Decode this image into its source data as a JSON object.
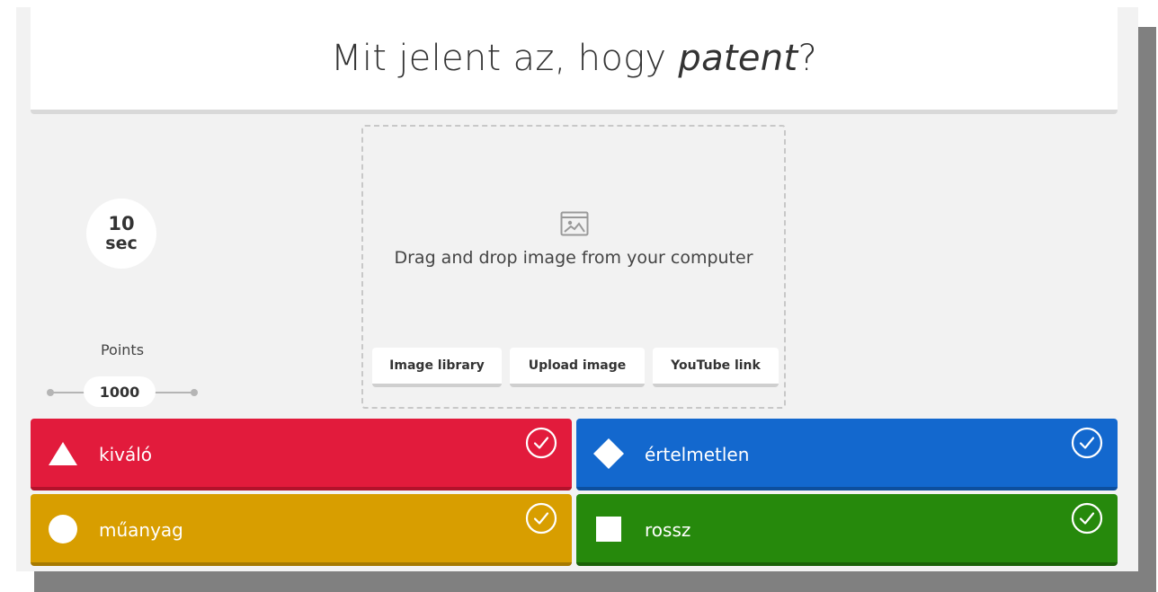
{
  "question": {
    "prefix": "Mit jelent az, hogy ",
    "emphasis": "patent",
    "suffix": "?"
  },
  "timer": {
    "value": "10",
    "unit": "sec"
  },
  "points": {
    "label": "Points",
    "value": "1000"
  },
  "media": {
    "drop_text": "Drag and drop image from your computer",
    "buttons": [
      "Image library",
      "Upload image",
      "YouTube link"
    ],
    "icon": "image-icon"
  },
  "answers": [
    {
      "text": "kiváló",
      "shape": "triangle",
      "color": "#e21b3c"
    },
    {
      "text": "értelmetlen",
      "shape": "diamond",
      "color": "#1368ce"
    },
    {
      "text": "műanyag",
      "shape": "circle",
      "color": "#d89e00"
    },
    {
      "text": "rossz",
      "shape": "square",
      "color": "#26890c"
    }
  ],
  "colors": {
    "background": "#f2f2f2",
    "shadow": "#808080"
  }
}
